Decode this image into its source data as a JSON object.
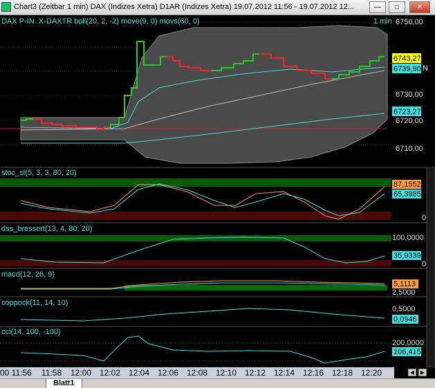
{
  "window": {
    "title": "Chart3 (Zeitbar 1 min)  DAX (Indizes Xetra) D1AR (Indizes Xetra) 19.07.2012 11:56 - 19.07.2012 12...",
    "minimize": "—",
    "maximize": "□",
    "close": "✕"
  },
  "main_panel": {
    "header": "DAX P-IN.  X-DAXTR boll(20, 2, -2) move(9, 0) movs(60, 0)",
    "interval": "1 min",
    "y_ticks": [
      "6750,00",
      "6740,00",
      "6730,00",
      "6720,00",
      "6710,00"
    ],
    "last_price": "6743,27",
    "labels": {
      "boll_mid": "6739,90",
      "movs": "6723,27"
    }
  },
  "panels": {
    "stoc": {
      "header": "stoc_sl(5, 3, 3, 80, 20)",
      "value1": "87,1552",
      "value2": "65,3985",
      "zero": "0"
    },
    "dss": {
      "header": "dss_bressert(13, 4, 80, 20)",
      "top": "100,0000",
      "value": "35,9339",
      "zero": "0"
    },
    "macd": {
      "header": "macd(12, 26, 9)",
      "value": "5,1113",
      "lower": "2,5000"
    },
    "coppock": {
      "header": "coppock(11, 14, 10)",
      "top": "0,5000",
      "value": "0,0946"
    },
    "cci": {
      "header": "cci(14, 100, -100)",
      "top": "200,0000",
      "value": "106,4151"
    }
  },
  "time_axis": [
    "00 11:56",
    "11:58",
    "12:00",
    "12:02",
    "12:04",
    "12:06",
    "12:08",
    "12:10",
    "12:12",
    "12:14",
    "12:16",
    "12:18",
    "12:20"
  ],
  "tabs": {
    "sheet": "Blatt1"
  },
  "colors": {
    "up": "#22cc22",
    "down": "#ff2222",
    "boll_band": "#4a4a4a",
    "cyan": "#40e0e0",
    "yellow_label": "#ffff00",
    "orange_label": "#ffa040"
  }
}
